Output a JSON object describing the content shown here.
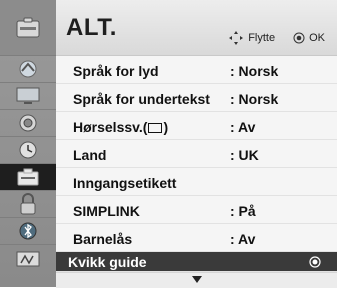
{
  "header": {
    "title": "ALT.",
    "move_hint": "Flytte",
    "ok_hint": "OK"
  },
  "sidebar": {
    "icons": [
      "setup-icon",
      "picture-icon",
      "audio-icon",
      "time-icon",
      "option-icon",
      "lock-icon",
      "network-icon",
      "input-icon"
    ],
    "active_index": 4
  },
  "menu": {
    "items": [
      {
        "label": "Språk for lyd",
        "value": ": Norsk"
      },
      {
        "label": "Språk for undertekst",
        "value": ": Norsk"
      },
      {
        "label": "Hørselssv.(",
        "label_suffix": ")",
        "value": ": Av"
      },
      {
        "label": "Land",
        "value": ": UK"
      },
      {
        "label": "Inngangsetikett",
        "value": ""
      },
      {
        "label": "SIMPLINK",
        "value": ": På"
      },
      {
        "label": "Barnelås",
        "value": ": Av"
      },
      {
        "label": "Kvikk guide",
        "value": ""
      }
    ],
    "selected_index": 7
  },
  "colors": {
    "selected_row": "#3a3a3a",
    "active_sidebar": "#1e1e1e",
    "sidebar": "#8c8c8c"
  }
}
